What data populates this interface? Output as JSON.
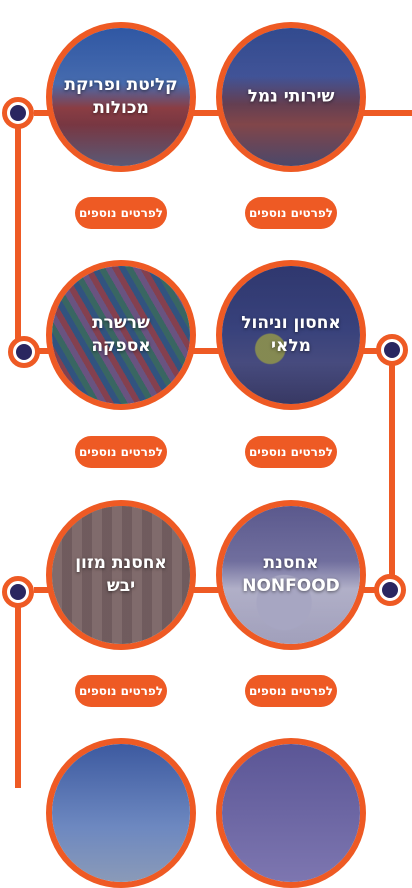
{
  "colors": {
    "accent": "#ee5a24",
    "node_center": "#2a2660",
    "photo_tint": "#35316f"
  },
  "services": [
    {
      "title": "שירותי נמל",
      "button": "לפרטים נוספים",
      "image": "port-trucks-photo"
    },
    {
      "title": "קליטת ופריקת מכולות",
      "button": "לפרטים נוספים",
      "image": "container-trucks-photo"
    },
    {
      "title": "אחסון וניהול מלאי",
      "button": "לפרטים נוספים",
      "image": "warehouse-worker-photo"
    },
    {
      "title": "שרשרת אספקה",
      "button": "לפרטים נוספים",
      "image": "container-port-aerial-photo"
    },
    {
      "title": "אחסנת NONFOOD",
      "button": "לפרטים נוספים",
      "image": "washing-machine-photo"
    },
    {
      "title": "אחסנת מזון יבש",
      "button": "לפרטים נוספים",
      "image": "grain-sacks-photo"
    },
    {
      "title": "",
      "button": "",
      "image": "service-photo-partial"
    },
    {
      "title": "",
      "button": "",
      "image": "service-photo-partial"
    }
  ]
}
